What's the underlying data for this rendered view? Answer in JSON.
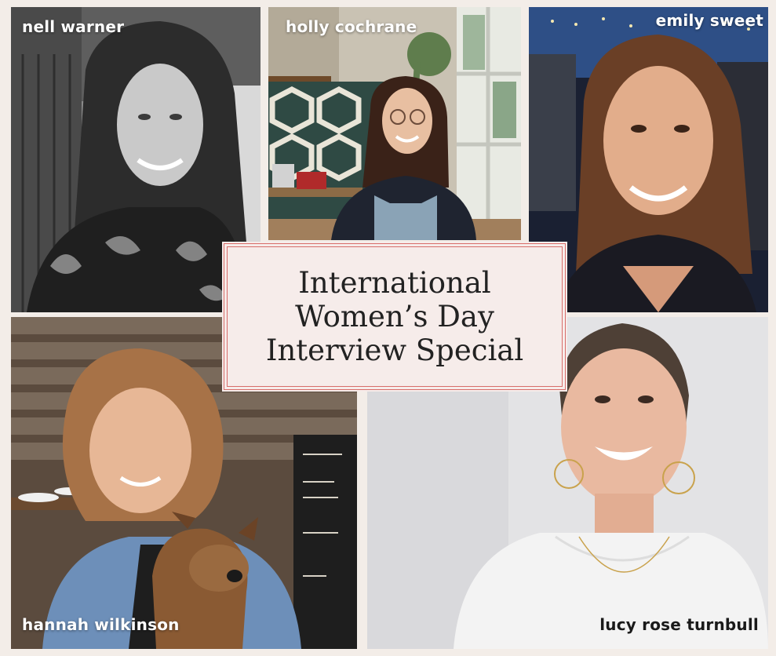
{
  "title_card": {
    "lines": [
      "International",
      "Women’s Day",
      "Interview Special"
    ],
    "border_color": "#d76d6a",
    "background": "#f6ecea"
  },
  "people": [
    {
      "name": "nell warner",
      "photo": "black-and-white portrait"
    },
    {
      "name": "holly cochrane",
      "photo": "kitchen portrait"
    },
    {
      "name": "emily sweet",
      "photo": "evening portrait"
    },
    {
      "name": "hannah wilkinson",
      "photo": "portrait with puppy"
    },
    {
      "name": "lucy rose turnbull",
      "photo": "studio portrait"
    }
  ],
  "colors": {
    "page_background": "#f3ede8",
    "name_text": "#ffffff",
    "name_text_dark": "#1a1a1a"
  }
}
